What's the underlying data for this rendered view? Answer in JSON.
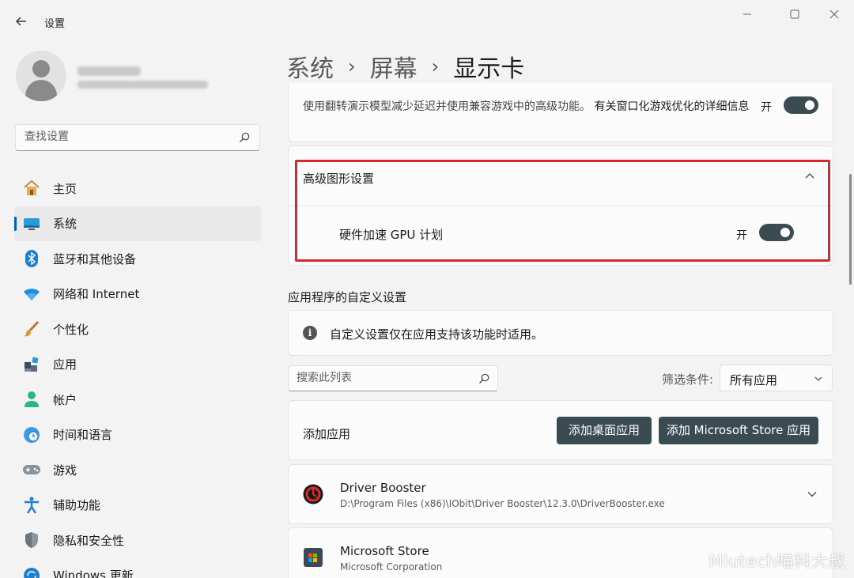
{
  "window": {
    "title": "设置",
    "back_icon": "arrow-left-icon",
    "controls": [
      "minimize-icon",
      "maximize-icon",
      "close-icon"
    ]
  },
  "sidebar": {
    "search_placeholder": "查找设置",
    "items": [
      {
        "label": "主页",
        "icon": "home-icon",
        "active": false
      },
      {
        "label": "系统",
        "icon": "system-icon",
        "active": true
      },
      {
        "label": "蓝牙和其他设备",
        "icon": "bluetooth-icon",
        "active": false
      },
      {
        "label": "网络和 Internet",
        "icon": "wifi-icon",
        "active": false
      },
      {
        "label": "个性化",
        "icon": "brush-icon",
        "active": false
      },
      {
        "label": "应用",
        "icon": "apps-icon",
        "active": false
      },
      {
        "label": "帐户",
        "icon": "account-icon",
        "active": false
      },
      {
        "label": "时间和语言",
        "icon": "clock-globe-icon",
        "active": false
      },
      {
        "label": "游戏",
        "icon": "gamepad-icon",
        "active": false
      },
      {
        "label": "辅助功能",
        "icon": "accessibility-icon",
        "active": false
      },
      {
        "label": "隐私和安全性",
        "icon": "shield-icon",
        "active": false
      },
      {
        "label": "Windows 更新",
        "icon": "update-icon",
        "active": false
      }
    ]
  },
  "breadcrumb": {
    "items": [
      "系统",
      "屏幕",
      "显示卡"
    ],
    "separator": "›"
  },
  "gpu_optimizations": {
    "description": "使用翻转演示模型减少延迟并使用兼容游戏中的高级功能。",
    "link": "有关窗口化游戏优化的详细信息",
    "toggle_label": "开",
    "toggle_on": true
  },
  "advanced_graphics": {
    "title": "高级图形设置",
    "row_label": "硬件加速 GPU 计划",
    "toggle_label": "开",
    "toggle_on": true,
    "expanded": true,
    "highlight_color": "#d9262c"
  },
  "app_settings": {
    "section_title": "应用程序的自定义设置",
    "info_text": "自定义设置仅在应用支持该功能时适用。",
    "list_search_placeholder": "搜索此列表",
    "filter_label": "筛选条件:",
    "filter_value": "所有应用",
    "add_label": "添加应用",
    "add_desktop_button": "添加桌面应用",
    "add_store_button": "添加 Microsoft Store 应用",
    "apps": [
      {
        "name": "Driver Booster",
        "path": "D:\\Program Files (x86)\\IObit\\Driver Booster\\12.3.0\\DriverBooster.exe",
        "icon": "driver-booster-icon"
      },
      {
        "name": "Microsoft Store",
        "path": "Microsoft Corporation",
        "icon": "microsoft-store-icon"
      }
    ]
  },
  "watermark": "Miutech喵科大叔",
  "colors": {
    "accent": "#005fb8",
    "toggle_on": "#3b4b52",
    "button_dark": "#3b4b52"
  }
}
